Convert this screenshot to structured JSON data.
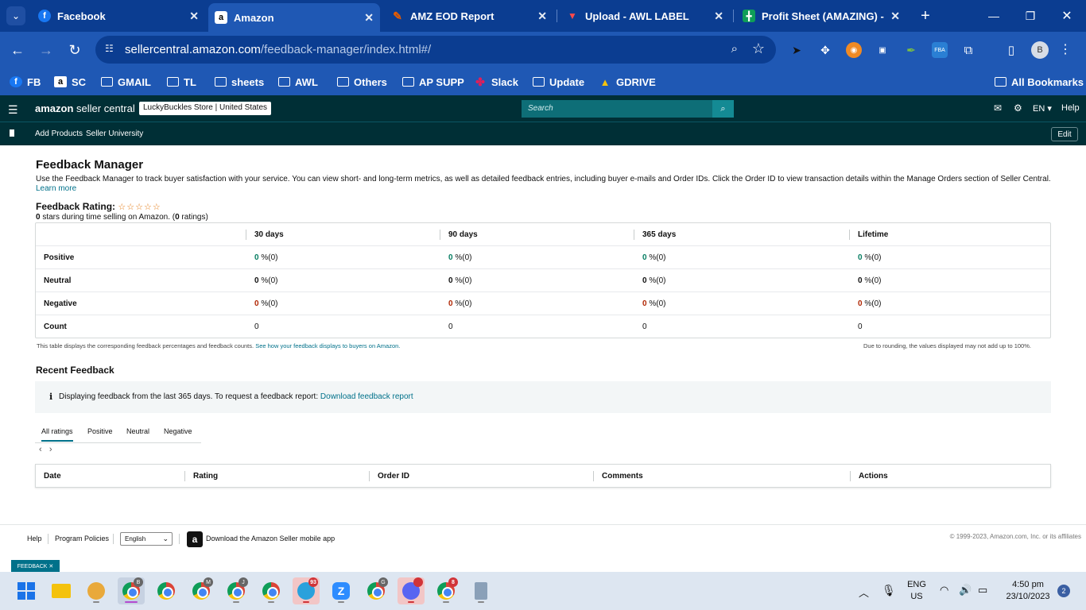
{
  "browser": {
    "tabs": [
      {
        "title": "Facebook",
        "favicon": "facebook-icon",
        "color": "#1877f2"
      },
      {
        "title": "Amazon",
        "favicon": "amazon-icon",
        "color": "#000000",
        "active": true
      },
      {
        "title": "AMZ EOD Report",
        "favicon": "edit-icon",
        "color": "#e65c00"
      },
      {
        "title": "Upload - AWL LABEL",
        "favicon": "label-icon",
        "color": "#cc1f1f"
      },
      {
        "title": "Profit Sheet (AMAZING) - G",
        "favicon": "sheets-icon",
        "color": "#0f9d58"
      }
    ],
    "url": {
      "host": "sellercentral.amazon.com",
      "path": "/feedback-manager/index.html#/"
    },
    "profile_initial": "B",
    "bookmarks": [
      {
        "label": "FB",
        "icon": "facebook-icon"
      },
      {
        "label": "SC",
        "icon": "amazon-icon"
      },
      {
        "label": "GMAIL",
        "icon": "folder-icon"
      },
      {
        "label": "TL",
        "icon": "folder-icon"
      },
      {
        "label": "sheets",
        "icon": "folder-icon"
      },
      {
        "label": "AWL",
        "icon": "folder-icon"
      },
      {
        "label": "Others",
        "icon": "folder-icon"
      },
      {
        "label": "AP SUPP",
        "icon": "folder-icon"
      },
      {
        "label": "Slack",
        "icon": "slack-icon"
      },
      {
        "label": "Update",
        "icon": "folder-icon"
      },
      {
        "label": "GDRIVE",
        "icon": "drive-icon"
      }
    ],
    "all_bookmarks": "All Bookmarks"
  },
  "sc_header": {
    "logo_brand": "amazon",
    "logo_rest": "seller central",
    "store": "LuckyBuckles Store | United States",
    "search_placeholder": "Search",
    "lang": "EN ▾",
    "help": "Help",
    "subnav": [
      "Add Products",
      "Seller University"
    ],
    "edit": "Edit"
  },
  "page": {
    "title": "Feedback Manager",
    "description": "Use the Feedback Manager to track buyer satisfaction with your service. You can view short- and long-term metrics, as well as detailed feedback entries, including buyer e-mails and Order IDs. Click the Order ID to view transaction details within the Manage Orders section of Seller Central.",
    "learn_more": "Learn more",
    "rating_label": "Feedback Rating:",
    "stars": "☆☆☆☆☆",
    "rating_stars_value": "0",
    "rating_text_mid": " stars during time selling on Amazon. (",
    "rating_count": "0",
    "rating_text_end": " ratings)"
  },
  "metrics_table": {
    "headers": [
      "30 days",
      "90 days",
      "365 days",
      "Lifetime"
    ],
    "rows": [
      {
        "label": "Positive",
        "values": [
          "0",
          "0",
          "0",
          "0"
        ],
        "suffix": " %(0)"
      },
      {
        "label": "Neutral",
        "values": [
          "0",
          "0",
          "0",
          "0"
        ],
        "suffix": " %(0)"
      },
      {
        "label": "Negative",
        "values": [
          "0",
          "0",
          "0",
          "0"
        ],
        "suffix": " %(0)"
      },
      {
        "label": "Count",
        "values": [
          "0",
          "0",
          "0",
          "0"
        ],
        "suffix": ""
      }
    ],
    "note_left_a": "This table displays the corresponding feedback percentages and feedback counts. ",
    "note_left_link": "See how your feedback displays to buyers on Amazon.",
    "note_right": "Due to rounding, the values displayed may not add up to 100%."
  },
  "recent": {
    "title": "Recent Feedback",
    "info_text": "Displaying feedback from the last 365 days. To request a feedback report: ",
    "info_link": "Download feedback report",
    "tabs": [
      "All ratings",
      "Positive",
      "Neutral",
      "Negative"
    ],
    "columns": [
      "Date",
      "Rating",
      "Order ID",
      "Comments",
      "Actions"
    ]
  },
  "footer": {
    "links": [
      "Help",
      "Program Policies"
    ],
    "language": "English",
    "app_text": "Download the Amazon Seller mobile app",
    "copyright": "© 1999-2023, Amazon.com, Inc. or its affiliates",
    "feedback_badge": "FEEDBACK ✕"
  },
  "taskbar": {
    "lang_top": "ENG",
    "lang_bottom": "US",
    "time": "4:50 pm",
    "date": "23/10/2023",
    "notifications": "2",
    "badges": {
      "profile_b": "B",
      "profile_m": "M",
      "profile_j": "J",
      "telegram": "93",
      "profile_g": "G",
      "discord": "",
      "chrome_red": "8"
    }
  },
  "colors": {
    "accent": "#00718a",
    "header": "#002f36",
    "chrome_blue": "#1f58b4",
    "positive": "#067d62",
    "negative": "#b12704"
  }
}
